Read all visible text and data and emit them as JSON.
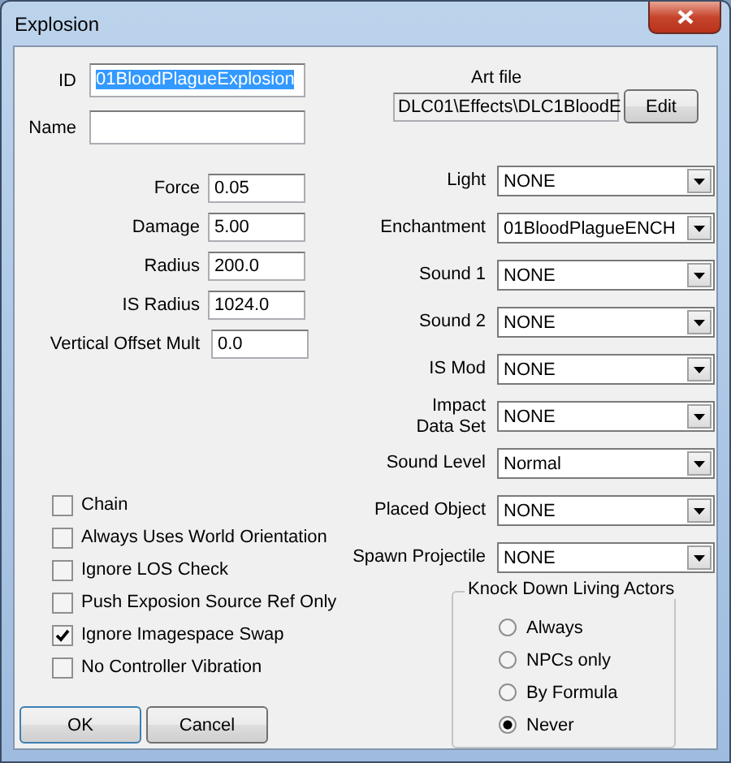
{
  "window": {
    "title": "Explosion"
  },
  "id_field": {
    "label": "ID",
    "value": "01BloodPlagueExplosion",
    "text_selected": true
  },
  "name_field": {
    "label": "Name"
  },
  "art_file": {
    "label": "Art file",
    "value": "DLC01\\Effects\\DLC1BloodE",
    "button": "Edit"
  },
  "numeric_fields": [
    {
      "label": "Force",
      "value": "0.05"
    },
    {
      "label": "Damage",
      "value": "5.00"
    },
    {
      "label": "Radius",
      "value": "200.0"
    },
    {
      "label": "IS Radius",
      "value": "1024.0"
    },
    {
      "label": "Vertical Offset Mult",
      "value": "0.0"
    }
  ],
  "dropdowns": [
    {
      "label": "Light",
      "value": "NONE"
    },
    {
      "label": "Enchantment",
      "value": "01BloodPlagueENCH"
    },
    {
      "label": "Sound 1",
      "value": "NONE"
    },
    {
      "label": "Sound 2",
      "value": "NONE"
    },
    {
      "label": "IS Mod",
      "value": "NONE"
    },
    {
      "label": "Impact\nData Set",
      "value": "NONE"
    },
    {
      "label": "Sound Level",
      "value": "Normal"
    },
    {
      "label": "Placed Object",
      "value": "NONE"
    },
    {
      "label": "Spawn Projectile",
      "value": "NONE"
    }
  ],
  "flags": [
    {
      "label": "Chain",
      "checked": false
    },
    {
      "label": "Always Uses World Orientation",
      "checked": false
    },
    {
      "label": "Ignore LOS Check",
      "checked": false
    },
    {
      "label": "Push Exposion Source Ref Only",
      "checked": false
    },
    {
      "label": "Ignore Imagespace Swap",
      "checked": true
    },
    {
      "label": "No Controller Vibration",
      "checked": false
    }
  ],
  "knock_down": {
    "title": "Knock Down Living Actors",
    "options": [
      {
        "label": "Always",
        "selected": false
      },
      {
        "label": "NPCs only",
        "selected": false
      },
      {
        "label": "By Formula",
        "selected": false
      },
      {
        "label": "Never",
        "selected": true
      }
    ]
  },
  "buttons": [
    {
      "label": "OK"
    },
    {
      "label": "Cancel"
    }
  ]
}
